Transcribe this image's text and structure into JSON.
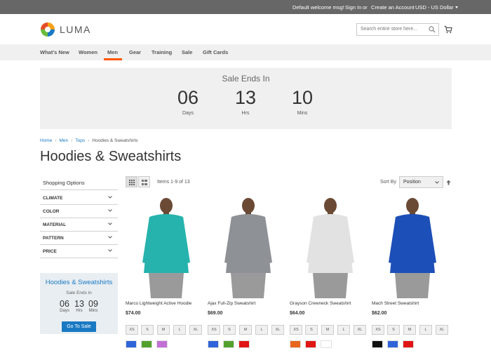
{
  "topbar": {
    "welcome": "Default welcome msg!",
    "sign_in": "Sign In",
    "or": "or",
    "create_account": "Create an Account",
    "currency": "USD - US Dollar"
  },
  "header": {
    "logo_text": "LUMA",
    "search_placeholder": "Search entire store here..."
  },
  "nav": {
    "items": [
      "What's New",
      "Women",
      "Men",
      "Gear",
      "Training",
      "Sale",
      "Gift Cards"
    ],
    "active": "Men"
  },
  "sale_banner": {
    "title": "Sale Ends In",
    "days": "06",
    "days_label": "Days",
    "hrs": "13",
    "hrs_label": "Hrs",
    "mins": "10",
    "mins_label": "Mins"
  },
  "breadcrumb": [
    "Home",
    "Men",
    "Tops",
    "Hoodies & Sweatshirts"
  ],
  "page_title": "Hoodies & Sweatshirts",
  "sidebar": {
    "shopping_options": "Shopping Options",
    "filters": [
      "CLIMATE",
      "COLOR",
      "MATERIAL",
      "PATTERN",
      "PRICE"
    ],
    "promo": {
      "title": "Hoodies & Sweatshirts",
      "subtitle": "Sale Ends in",
      "days": "06",
      "days_label": "Days",
      "hrs": "13",
      "hrs_label": "Hrs",
      "mins": "09",
      "mins_label": "Mins",
      "button": "Go To Sale"
    }
  },
  "toolbar": {
    "items_count": "Items 1-9 of 13",
    "sort_by": "Sort By",
    "sort_value": "Position"
  },
  "products": [
    {
      "name": "Marco Lightweight Active Hoodie",
      "price": "$74.00",
      "sizes": [
        "XS",
        "S",
        "M",
        "L",
        "XL"
      ],
      "swatches": [
        "#2f64d8",
        "#53a12c",
        "#c26fd6"
      ],
      "garment": "#27b3ad"
    },
    {
      "name": "Ajax Full-Zip Sweatshirt",
      "price": "$69.00",
      "sizes": [
        "XS",
        "S",
        "M",
        "L",
        "XL"
      ],
      "swatches": [
        "#2f64d8",
        "#53a12c",
        "#e01515"
      ],
      "garment": "#8e9196"
    },
    {
      "name": "Grayson Crewneck Sweatshirt",
      "price": "$64.00",
      "sizes": [
        "XS",
        "S",
        "M",
        "L",
        "XL"
      ],
      "swatches": [
        "#e8671f",
        "#e01515",
        "#ffffff"
      ],
      "garment": "#e2e2e2"
    },
    {
      "name": "Mach Street Sweatshirt",
      "price": "$62.00",
      "sizes": [
        "XS",
        "S",
        "M",
        "L",
        "XL"
      ],
      "swatches": [
        "#111111",
        "#2f64d8",
        "#e01515"
      ],
      "garment": "#1d4fb8"
    }
  ]
}
